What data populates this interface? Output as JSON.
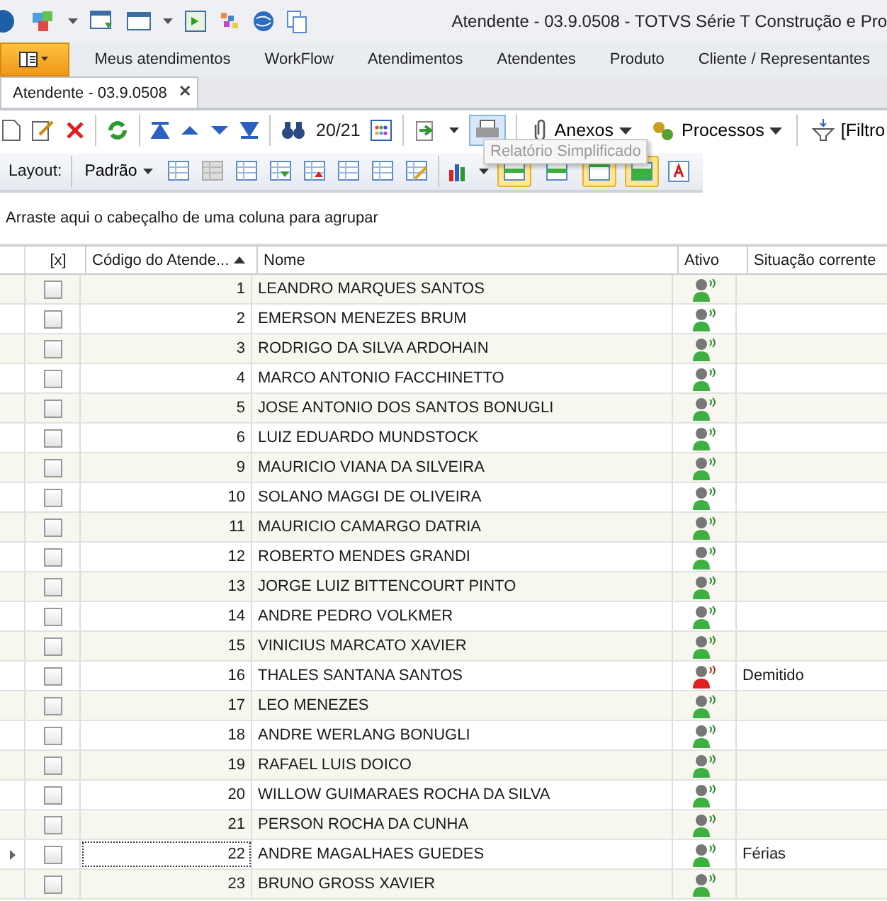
{
  "window": {
    "title": "Atendente - 03.9.0508 - TOTVS Série T Construção e Pro"
  },
  "ribbon_tabs": [
    {
      "label": "Meus atendimentos",
      "selected": false
    },
    {
      "label": "WorkFlow",
      "selected": false
    },
    {
      "label": "Atendimentos",
      "selected": false
    },
    {
      "label": "Atendentes",
      "selected": false
    },
    {
      "label": "Produto",
      "selected": false
    },
    {
      "label": "Cliente / Representantes",
      "selected": false
    }
  ],
  "document_tab": {
    "label": "Atendente - 03.9.0508",
    "close": "✕"
  },
  "toolbar": {
    "record_counter": "20/21",
    "attachments": "Anexos",
    "processes": "Processos",
    "filter": "[Filtro",
    "tooltip": "Relatório Simplificado"
  },
  "layout_bar": {
    "label": "Layout:",
    "layout": "Padrão"
  },
  "group_panel": {
    "hint": "Arraste aqui o cabeçalho de uma coluna para agrupar"
  },
  "table": {
    "columns": [
      "[x]",
      "Código do Atende...",
      "Nome",
      "Ativo",
      "Situação corrente"
    ],
    "rows": [
      {
        "code": "1",
        "name": "LEANDRO MARQUES SANTOS",
        "active": true,
        "status": "",
        "checked": false,
        "selected": false
      },
      {
        "code": "2",
        "name": "EMERSON MENEZES BRUM",
        "active": true,
        "status": "",
        "checked": false,
        "selected": false
      },
      {
        "code": "3",
        "name": "RODRIGO DA SILVA ARDOHAIN",
        "active": true,
        "status": "",
        "checked": false,
        "selected": false
      },
      {
        "code": "4",
        "name": "MARCO ANTONIO FACCHINETTO",
        "active": true,
        "status": "",
        "checked": false,
        "selected": false
      },
      {
        "code": "5",
        "name": "JOSE ANTONIO DOS SANTOS BONUGLI",
        "active": true,
        "status": "",
        "checked": false,
        "selected": false
      },
      {
        "code": "6",
        "name": "LUIZ EDUARDO MUNDSTOCK",
        "active": true,
        "status": "",
        "checked": false,
        "selected": false
      },
      {
        "code": "9",
        "name": "MAURICIO VIANA DA SILVEIRA",
        "active": true,
        "status": "",
        "checked": false,
        "selected": false
      },
      {
        "code": "10",
        "name": "SOLANO MAGGI DE OLIVEIRA",
        "active": true,
        "status": "",
        "checked": false,
        "selected": false
      },
      {
        "code": "11",
        "name": "MAURICIO CAMARGO DATRIA",
        "active": true,
        "status": "",
        "checked": false,
        "selected": false
      },
      {
        "code": "12",
        "name": "ROBERTO MENDES GRANDI",
        "active": true,
        "status": "",
        "checked": false,
        "selected": false
      },
      {
        "code": "13",
        "name": "JORGE LUIZ BITTENCOURT PINTO",
        "active": true,
        "status": "",
        "checked": false,
        "selected": false
      },
      {
        "code": "14",
        "name": "ANDRE PEDRO VOLKMER",
        "active": true,
        "status": "",
        "checked": false,
        "selected": false
      },
      {
        "code": "15",
        "name": "VINICIUS MARCATO XAVIER",
        "active": true,
        "status": "",
        "checked": false,
        "selected": false
      },
      {
        "code": "16",
        "name": "THALES SANTANA SANTOS",
        "active": false,
        "status": "Demitido",
        "checked": false,
        "selected": false
      },
      {
        "code": "17",
        "name": "LEO MENEZES",
        "active": true,
        "status": "",
        "checked": false,
        "selected": false
      },
      {
        "code": "18",
        "name": "ANDRE WERLANG BONUGLI",
        "active": true,
        "status": "",
        "checked": false,
        "selected": false
      },
      {
        "code": "19",
        "name": "RAFAEL LUIS DOICO",
        "active": true,
        "status": "",
        "checked": false,
        "selected": false
      },
      {
        "code": "20",
        "name": "WILLOW GUIMARAES ROCHA DA SILVA",
        "active": true,
        "status": "",
        "checked": false,
        "selected": false
      },
      {
        "code": "21",
        "name": "PERSON ROCHA DA CUNHA",
        "active": true,
        "status": "",
        "checked": false,
        "selected": false
      },
      {
        "code": "22",
        "name": "ANDRE MAGALHAES GUEDES",
        "active": true,
        "status": "Férias",
        "checked": false,
        "selected": true
      },
      {
        "code": "23",
        "name": "BRUNO GROSS XAVIER",
        "active": true,
        "status": "",
        "checked": false,
        "selected": false
      }
    ]
  }
}
